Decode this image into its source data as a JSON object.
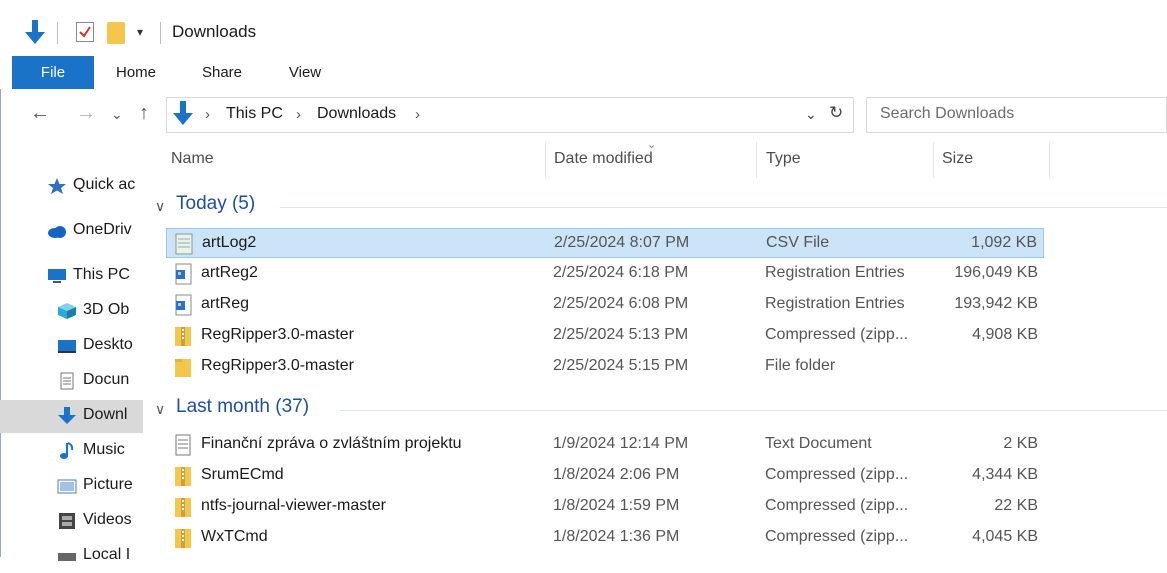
{
  "title": "Downloads",
  "quick_access": {
    "dropdown_glyph": "▾"
  },
  "ribbon": {
    "tabs": [
      "File",
      "Home",
      "Share",
      "View"
    ]
  },
  "address": {
    "crumbs": [
      "This PC",
      "Downloads"
    ],
    "separator": "›",
    "dropdown_glyph": "⌄",
    "refresh_glyph": "↻"
  },
  "nav_buttons": {
    "back": "←",
    "forward": "→",
    "recent": "⌄",
    "up": "↑"
  },
  "search": {
    "placeholder": "Search Downloads"
  },
  "nav_pane": {
    "items": [
      {
        "label": "Quick ac",
        "icon": "star-icon",
        "color": "#2f6fc4"
      },
      {
        "label": "OneDriv",
        "icon": "cloud-icon",
        "color": "#1565c0"
      },
      {
        "label": "This PC",
        "icon": "computer-icon",
        "color": "#1a73c8"
      },
      {
        "label": "3D Ob",
        "icon": "cube-icon",
        "color": "#2aa9d8"
      },
      {
        "label": "Deskto",
        "icon": "desktop-icon",
        "color": "#1a73c8"
      },
      {
        "label": "Docun",
        "icon": "document-icon",
        "color": "#777777"
      },
      {
        "label": "Downl",
        "icon": "download-icon",
        "color": "#1a73c8"
      },
      {
        "label": "Music",
        "icon": "music-icon",
        "color": "#1a73c8"
      },
      {
        "label": "Picture",
        "icon": "pictures-icon",
        "color": "#4a7fb5"
      },
      {
        "label": "Videos",
        "icon": "film-icon",
        "color": "#444444"
      },
      {
        "label": "Local I",
        "icon": "drive-icon",
        "color": "#666666"
      }
    ],
    "selected_index": 6
  },
  "columns": {
    "name": "Name",
    "date": "Date modified",
    "type": "Type",
    "size": "Size",
    "sort_glyph": "⌄"
  },
  "groups": [
    {
      "label": "Today (5)",
      "caret": "∨",
      "rows": [
        {
          "name": "artLog2",
          "date": "2/25/2024 8:07 PM",
          "type": "CSV File",
          "size": "1,092 KB",
          "icon": "csv-file-icon"
        },
        {
          "name": "artReg2",
          "date": "2/25/2024 6:18 PM",
          "type": "Registration Entries",
          "size": "196,049 KB",
          "icon": "registry-file-icon"
        },
        {
          "name": "artReg",
          "date": "2/25/2024 6:08 PM",
          "type": "Registration Entries",
          "size": "193,942 KB",
          "icon": "registry-file-icon"
        },
        {
          "name": "RegRipper3.0-master",
          "date": "2/25/2024 5:13 PM",
          "type": "Compressed (zipp...",
          "size": "4,908 KB",
          "icon": "zip-folder-icon"
        },
        {
          "name": "RegRipper3.0-master",
          "date": "2/25/2024 5:15 PM",
          "type": "File folder",
          "size": "",
          "icon": "folder-icon"
        }
      ]
    },
    {
      "label": "Last month (37)",
      "caret": "∨",
      "rows": [
        {
          "name": "Finanční zpráva o zvláštním projektu",
          "date": "1/9/2024 12:14 PM",
          "type": "Text Document",
          "size": "2 KB",
          "icon": "text-file-icon"
        },
        {
          "name": "SrumECmd",
          "date": "1/8/2024 2:06 PM",
          "type": "Compressed (zipp...",
          "size": "4,344 KB",
          "icon": "zip-folder-icon"
        },
        {
          "name": "ntfs-journal-viewer-master",
          "date": "1/8/2024 1:59 PM",
          "type": "Compressed (zipp...",
          "size": "22 KB",
          "icon": "zip-folder-icon"
        },
        {
          "name": "WxTCmd",
          "date": "1/8/2024 1:36 PM",
          "type": "Compressed (zipp...",
          "size": "4,045 KB",
          "icon": "zip-folder-icon"
        }
      ]
    }
  ],
  "selected_file": "artLog2",
  "colors": {
    "accent": "#1a73c8",
    "selection": "#cce4f7",
    "group_text": "#1e4e9c",
    "folder": "#f4c64c"
  }
}
